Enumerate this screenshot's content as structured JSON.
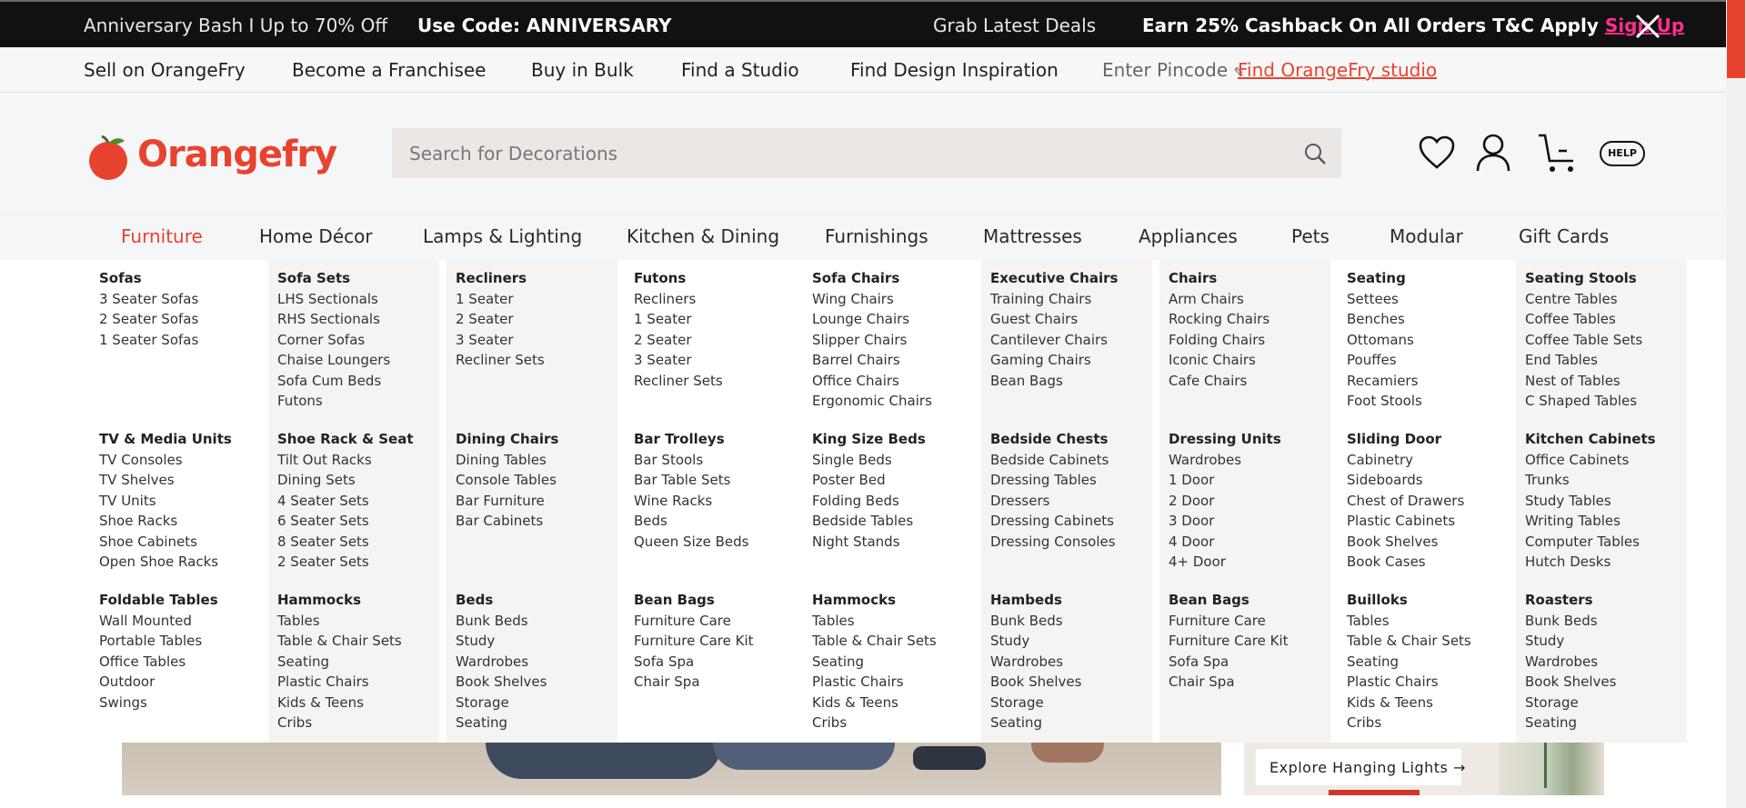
{
  "promo": {
    "sale": "Anniversary Bash I Up to 70% Off",
    "code": "Use Code: ANNIVERSARY",
    "deals": "Grab Latest Deals",
    "cashback": "Earn 25% Cashback On All Orders T&C Apply",
    "signup": "Sign Up"
  },
  "utility": {
    "sell": "Sell on OrangeFry",
    "franchise": "Become a Franchisee",
    "bulk": "Buy in Bulk",
    "studio": "Find a Studio",
    "inspiration": "Find Design Inspiration",
    "pincode": "Enter Pincode",
    "find_studio": "Find OrangeFry studio"
  },
  "header": {
    "brand": "Orangefry",
    "search_placeholder": "Search for Decorations",
    "help": "HELP"
  },
  "nav": [
    "Furniture",
    "Home Décor",
    "Lamps & Lighting",
    "Kitchen & Dining",
    "Furnishings",
    "Mattresses",
    "Appliances",
    "Pets",
    "Modular",
    "Gift Cards"
  ],
  "mega": [
    [
      {
        "title": "Sofas",
        "items": [
          "3 Seater Sofas",
          "2 Seater Sofas",
          "1 Seater Sofas"
        ]
      },
      {
        "title": "TV & Media Units",
        "items": [
          "TV Consoles",
          "TV Shelves",
          "TV Units",
          "Shoe Racks",
          "Shoe Cabinets",
          "Open Shoe Racks"
        ]
      },
      {
        "title": "Foldable Tables",
        "items": [
          "Wall Mounted",
          "Portable Tables",
          "Office Tables",
          "Outdoor",
          "Swings"
        ]
      }
    ],
    [
      {
        "title": "Sofa Sets",
        "items": [
          "LHS Sectionals",
          "RHS Sectionals",
          "Corner Sofas",
          "Chaise Loungers",
          "Sofa Cum Beds",
          "Futons"
        ]
      },
      {
        "title": "Shoe Rack & Seat",
        "items": [
          "Tilt Out Racks",
          "Dining Sets",
          "4 Seater Sets",
          "6 Seater Sets",
          "8 Seater Sets",
          "2 Seater Sets"
        ]
      },
      {
        "title": "Hammocks",
        "items": [
          "Tables",
          "Table & Chair Sets",
          "Seating",
          "Plastic Chairs",
          "Kids & Teens",
          "Cribs"
        ]
      }
    ],
    [
      {
        "title": "Recliners",
        "items": [
          "1 Seater",
          "2 Seater",
          "3 Seater",
          "Recliner Sets"
        ]
      },
      {
        "title": "Dining Chairs",
        "items": [
          "Dining Tables",
          "Console Tables",
          "Bar Furniture",
          "Bar Cabinets"
        ]
      },
      {
        "title": "Beds",
        "items": [
          "Bunk Beds",
          "Study",
          "Wardrobes",
          "Book Shelves",
          "Storage",
          "Seating"
        ]
      }
    ],
    [
      {
        "title": "Futons",
        "items": [
          "Recliners",
          "1 Seater",
          "2 Seater",
          "3 Seater",
          "Recliner Sets"
        ]
      },
      {
        "title": "Bar Trolleys",
        "items": [
          "Bar Stools",
          "Bar Table Sets",
          "Wine Racks",
          "Beds",
          "Queen Size Beds"
        ]
      },
      {
        "title": "Bean Bags",
        "items": [
          "Furniture Care",
          "Furniture Care Kit",
          "Sofa Spa",
          "Chair Spa"
        ]
      }
    ],
    [
      {
        "title": "Sofa Chairs",
        "items": [
          "Wing Chairs",
          "Lounge Chairs",
          "Slipper Chairs",
          "Barrel Chairs",
          "Office Chairs",
          "Ergonomic Chairs"
        ]
      },
      {
        "title": "King Size Beds",
        "items": [
          "Single Beds",
          "Poster Bed",
          "Folding Beds",
          "Bedside Tables",
          "Night Stands"
        ]
      },
      {
        "title": "Hammocks",
        "items": [
          "Tables",
          "Table & Chair Sets",
          "Seating",
          "Plastic Chairs",
          "Kids & Teens",
          "Cribs"
        ]
      }
    ],
    [
      {
        "title": "Executive Chairs",
        "items": [
          "Training Chairs",
          "Guest Chairs",
          "Cantilever Chairs",
          "Gaming Chairs",
          "Bean Bags"
        ]
      },
      {
        "title": "Bedside Chests",
        "items": [
          "Bedside Cabinets",
          "Dressing Tables",
          "Dressers",
          "Dressing Cabinets",
          "Dressing Consoles"
        ]
      },
      {
        "title": "Hambeds",
        "items": [
          "Bunk Beds",
          "Study",
          "Wardrobes",
          "Book Shelves",
          "Storage",
          "Seating"
        ]
      }
    ],
    [
      {
        "title": "Chairs",
        "items": [
          "Arm Chairs",
          "Rocking Chairs",
          "Folding Chairs",
          "Iconic Chairs",
          "Cafe Chairs"
        ]
      },
      {
        "title": "Dressing Units",
        "items": [
          "Wardrobes",
          "1 Door",
          "2 Door",
          "3 Door",
          "4 Door",
          "4+ Door"
        ]
      },
      {
        "title": "Bean Bags",
        "items": [
          "Furniture Care",
          "Furniture Care Kit",
          "Sofa Spa",
          "Chair Spa"
        ]
      }
    ],
    [
      {
        "title": "Seating",
        "items": [
          "Settees",
          "Benches",
          "Ottomans",
          "Pouffes",
          "Recamiers",
          "Foot Stools"
        ]
      },
      {
        "title": "Sliding Door",
        "items": [
          "Cabinetry",
          "Sideboards",
          "Chest of Drawers",
          "Plastic Cabinets",
          "Book Shelves",
          "Book Cases"
        ]
      },
      {
        "title": "Builloks",
        "items": [
          "Tables",
          "Table & Chair Sets",
          "Seating",
          "Plastic Chairs",
          "Kids & Teens",
          "Cribs"
        ]
      }
    ],
    [
      {
        "title": "Seating Stools",
        "items": [
          "Centre Tables",
          "Coffee Tables",
          "Coffee Table Sets",
          "End Tables",
          "Nest of Tables",
          "C Shaped Tables"
        ]
      },
      {
        "title": "Kitchen Cabinets",
        "items": [
          "Office Cabinets",
          "Trunks",
          "Study Tables",
          "Writing Tables",
          "Computer Tables",
          "Hutch Desks"
        ]
      },
      {
        "title": "Roasters",
        "items": [
          "Bunk Beds",
          "Study",
          "Wardrobes",
          "Book Shelves",
          "Storage",
          "Seating"
        ]
      }
    ]
  ],
  "promo_card": {
    "label": "Explore Hanging Lights"
  },
  "colors": {
    "accent": "#e8432f",
    "signup": "#ff2d8d",
    "topbar": "#111111"
  }
}
